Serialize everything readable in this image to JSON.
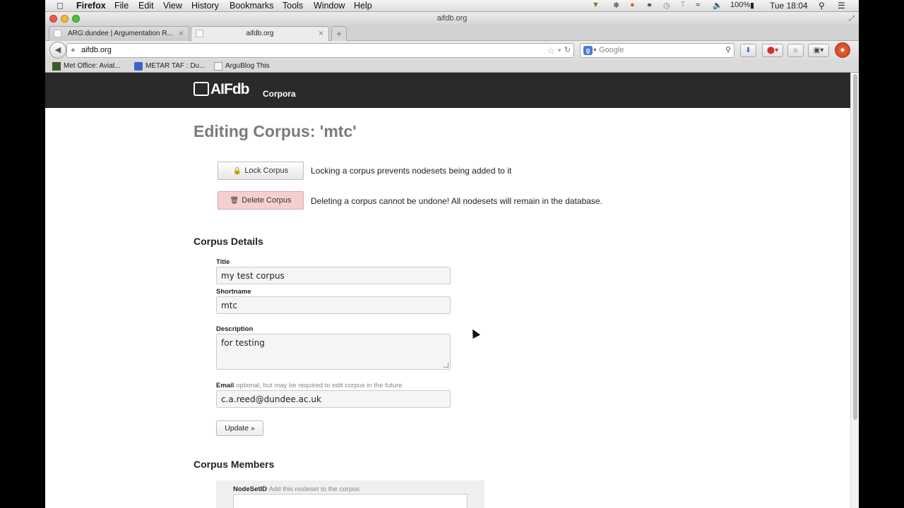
{
  "menubar": {
    "app_name": "Firefox",
    "items": [
      "File",
      "Edit",
      "View",
      "History",
      "Bookmarks",
      "Tools",
      "Window",
      "Help"
    ],
    "battery": "100%",
    "clock": "Tue 18:04"
  },
  "window": {
    "title": "aifdb.org"
  },
  "tabs": [
    {
      "label": "ARG:dundee | Argumentation R..."
    },
    {
      "label": "aifdb.org"
    }
  ],
  "navbar": {
    "url": "aifdb.org",
    "search_placeholder": "Google"
  },
  "bookmarks": [
    {
      "label": "Met Office: Aviat..."
    },
    {
      "label": "METAR TAF : Du..."
    },
    {
      "label": "ArguBlog This"
    }
  ],
  "site": {
    "logo": "AIFdb",
    "nav_link": "Corpora"
  },
  "page": {
    "heading": "Editing Corpus: 'mtc'",
    "lock_button": "Lock Corpus",
    "lock_note": "Locking a corpus prevents nodesets being added to it",
    "delete_button": "Delete Corpus",
    "delete_note": "Deleting a corpus cannot be undone! All nodesets will remain in the database.",
    "details_heading": "Corpus Details",
    "title_label": "Title",
    "title_value": "my test corpus",
    "shortname_label": "Shortname",
    "shortname_value": "mtc",
    "description_label": "Description",
    "description_value": "for testing",
    "email_label": "Email",
    "email_hint": "optional, but may be required to edit corpus in the future",
    "email_value": "c.a.reed@dundee.ac.uk",
    "update_button": "Update »",
    "members_heading": "Corpus Members",
    "nodeset_label": "NodeSetID",
    "nodeset_hint": "Add this nodeset to the corpus"
  },
  "colors": {
    "site_header": "#2a2a2a",
    "delete_button": "#f6d0d0",
    "heading_gray": "#7a7a7a"
  }
}
